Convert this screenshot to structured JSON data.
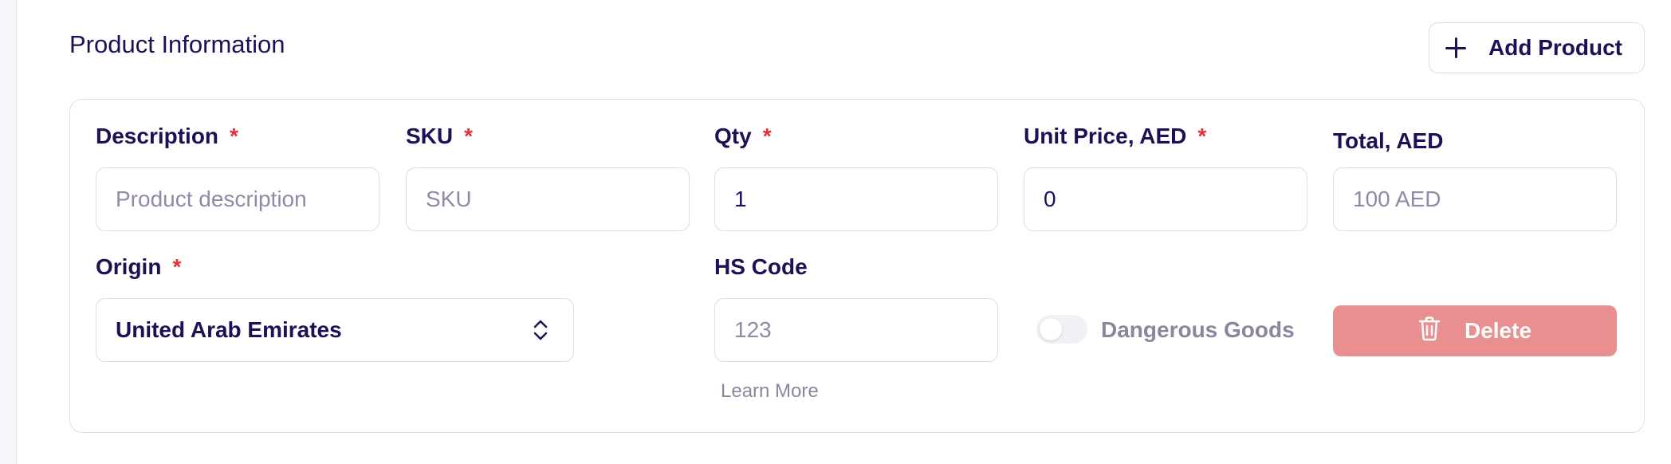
{
  "header": {
    "title": "Product Information",
    "add_button_label": "Add Product"
  },
  "form": {
    "required_mark": "*",
    "description": {
      "label": "Description",
      "placeholder": "Product description",
      "value": ""
    },
    "sku": {
      "label": "SKU",
      "placeholder": "SKU",
      "value": ""
    },
    "qty": {
      "label": "Qty",
      "value": "1"
    },
    "unit_price": {
      "label": "Unit Price, AED",
      "value": "0"
    },
    "total": {
      "label": "Total, AED",
      "placeholder": "100 AED"
    },
    "origin": {
      "label": "Origin",
      "value": "United Arab Emirates"
    },
    "hs_code": {
      "label": "HS Code",
      "placeholder": "123",
      "helper_link": "Learn More"
    },
    "dangerous_goods": {
      "label": "Dangerous Goods",
      "enabled": false
    },
    "delete_button_label": "Delete"
  },
  "colors": {
    "primary_text": "#1c1157",
    "required": "#e0313c",
    "delete_bg": "#ea8f90",
    "muted": "#8a86a0"
  },
  "icons": {
    "add": "plus-icon",
    "select": "chevron-up-down-icon",
    "delete": "trash-icon"
  }
}
